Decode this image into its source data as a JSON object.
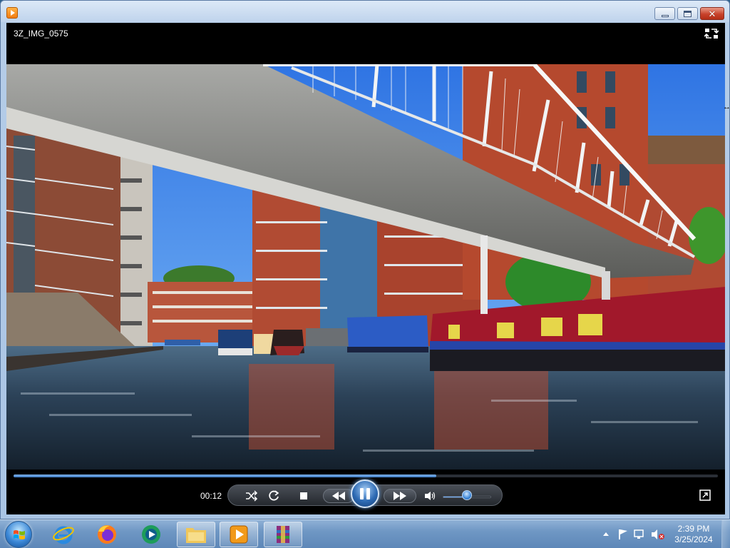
{
  "window": {
    "app_icon": "media-player-icon",
    "controls": [
      "minimize-icon",
      "maximize-icon",
      "close-icon"
    ]
  },
  "player": {
    "video_title": "3Z_IMG_0575",
    "elapsed_time": "00:12",
    "seek_progress": 0.6,
    "volume_level": 0.5,
    "accent_color": "#3f7cc6",
    "icons": [
      "switch-to-library-icon",
      "shuffle-icon",
      "repeat-icon",
      "stop-icon",
      "previous-icon",
      "pause-icon",
      "next-icon",
      "speaker-icon",
      "fullscreen-icon"
    ]
  },
  "taskbar": {
    "pinned": [
      {
        "name": "internet-explorer-icon"
      },
      {
        "name": "firefox-icon"
      },
      {
        "name": "media-center-icon"
      },
      {
        "name": "file-explorer-icon"
      },
      {
        "name": "media-player-icon"
      },
      {
        "name": "winrar-icon"
      }
    ],
    "tray_icons": [
      "show-hidden-icons-chevron",
      "action-center-flag-icon",
      "network-icon",
      "volume-muted-icon"
    ],
    "clock": {
      "time": "2:39 PM",
      "date": "3/25/2024"
    }
  }
}
